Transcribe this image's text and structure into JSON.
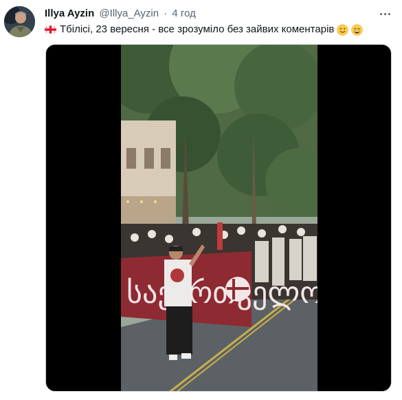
{
  "tweet": {
    "author": {
      "display_name": "Illya Ayzin",
      "handle": "@Illya_Ayzin",
      "separator": "·",
      "time": "4 год"
    },
    "text": "Тбілісі, 23 вересня - все зрозуміло без зайвих коментарів",
    "icons": {
      "flag": "georgia-flag-icon",
      "emoji_1": "winking-face-icon",
      "emoji_2": "grinning-face-icon",
      "more": "more-options-icon"
    },
    "media": {
      "type": "video",
      "banner_text": "საქართველო"
    }
  },
  "colors": {
    "text_primary": "#0f1419",
    "text_secondary": "#536471",
    "media_background": "#000000",
    "banner_red": "#8e2a32"
  }
}
